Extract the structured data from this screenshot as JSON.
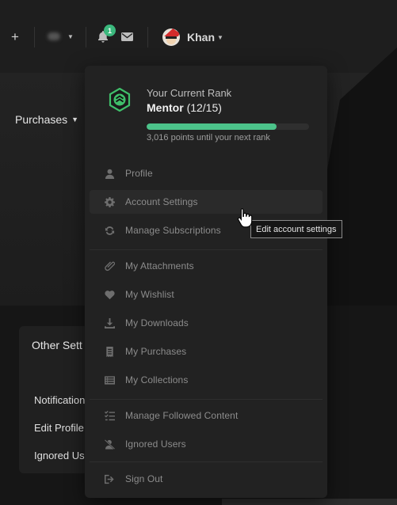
{
  "header": {
    "add_label": "+",
    "username": "Khan",
    "notification_count": "1"
  },
  "page": {
    "purchases_label": "Purchases",
    "settings_card": {
      "title": "Other Sett",
      "links": [
        "Notification",
        "Edit Profile",
        "Ignored Us"
      ]
    }
  },
  "rank": {
    "label": "Your Current Rank",
    "name": "Mentor",
    "progress_text": "(12/15)",
    "progress_fraction": 0.8,
    "next_rank_text": "3,016 points until your next rank",
    "accent_color": "#4cc38a"
  },
  "menu": {
    "groups": [
      [
        {
          "label": "Profile",
          "icon": "user-icon"
        },
        {
          "label": "Account Settings",
          "icon": "gear-icon",
          "hovered": true
        },
        {
          "label": "Manage Subscriptions",
          "icon": "refresh-icon"
        }
      ],
      [
        {
          "label": "My Attachments",
          "icon": "paperclip-icon"
        },
        {
          "label": "My Wishlist",
          "icon": "heart-icon"
        },
        {
          "label": "My Downloads",
          "icon": "download-icon"
        },
        {
          "label": "My Purchases",
          "icon": "receipt-icon"
        },
        {
          "label": "My Collections",
          "icon": "list-icon"
        }
      ],
      [
        {
          "label": "Manage Followed Content",
          "icon": "checklist-icon"
        },
        {
          "label": "Ignored Users",
          "icon": "user-slash-icon"
        }
      ],
      [
        {
          "label": "Sign Out",
          "icon": "sign-out-icon"
        }
      ]
    ]
  },
  "tooltip": {
    "text": "Edit account settings"
  }
}
